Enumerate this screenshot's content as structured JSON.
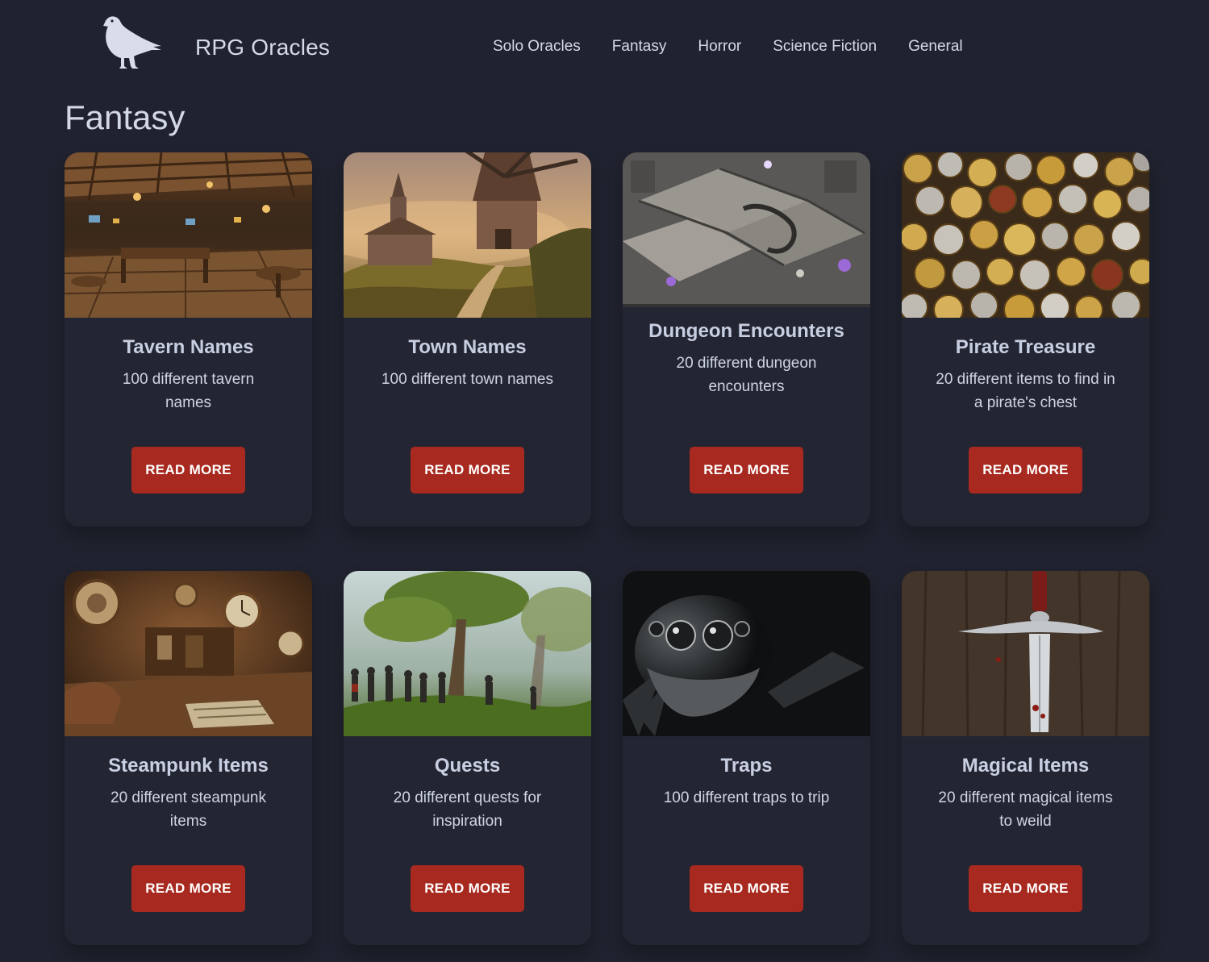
{
  "header": {
    "brand": "RPG Oracles",
    "logo_icon": "raven-icon",
    "nav": [
      {
        "label": "Solo Oracles"
      },
      {
        "label": "Fantasy"
      },
      {
        "label": "Horror"
      },
      {
        "label": "Science Fiction"
      },
      {
        "label": "General"
      }
    ]
  },
  "page": {
    "title": "Fantasy"
  },
  "cards": [
    {
      "title": "Tavern Names",
      "description": "100 different tavern names",
      "button": "READ MORE",
      "image": "tavern-interior-image"
    },
    {
      "title": "Town Names",
      "description": "100 different town names",
      "button": "READ MORE",
      "image": "windmill-town-image"
    },
    {
      "title": "Dungeon Encounters",
      "description": "20 different dungeon encounters",
      "button": "READ MORE",
      "image": "dungeon-map-image"
    },
    {
      "title": "Pirate Treasure",
      "description": "20 different items to find in a pirate's chest",
      "button": "READ MORE",
      "image": "coins-image"
    },
    {
      "title": "Steampunk Items",
      "description": "20 different steampunk items",
      "button": "READ MORE",
      "image": "steampunk-room-image"
    },
    {
      "title": "Quests",
      "description": "20 different quests for inspiration",
      "button": "READ MORE",
      "image": "forest-party-image"
    },
    {
      "title": "Traps",
      "description": "100 different traps to trip",
      "button": "READ MORE",
      "image": "spider-image"
    },
    {
      "title": "Magical Items",
      "description": "20 different magical items to weild",
      "button": "READ MORE",
      "image": "sword-image"
    }
  ],
  "colors": {
    "background": "#20232f",
    "card": "#232632",
    "button": "#a8291f",
    "title": "#c9cfe2"
  }
}
